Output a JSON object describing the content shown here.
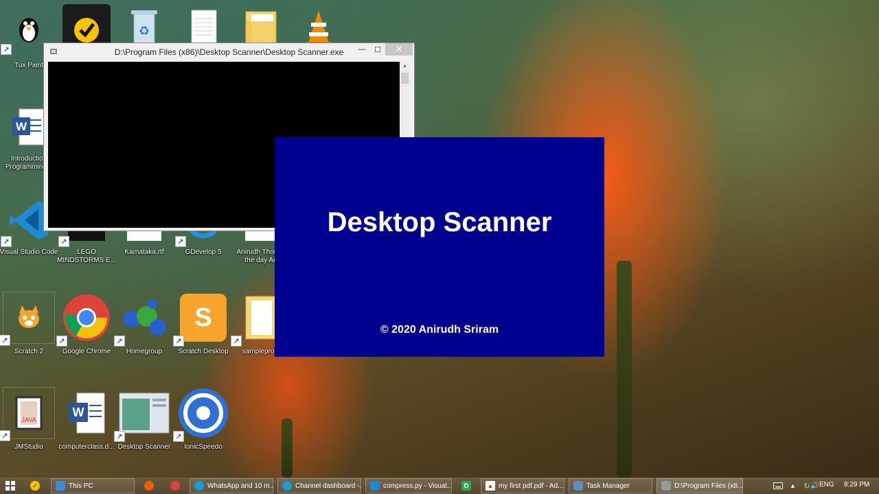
{
  "desktop": {
    "icons": [
      {
        "label": "Tux Paint"
      },
      {
        "label": "Introduction Programming..."
      },
      {
        "label": "Visual Studio Code"
      },
      {
        "label": "LEGO MINDSTORMS E..."
      },
      {
        "label": "Karnataka.rtf"
      },
      {
        "label": "GDevelop 5"
      },
      {
        "label": "Anirudh Thou of the day Au"
      },
      {
        "label": "Scratch 2"
      },
      {
        "label": "Google Chrome"
      },
      {
        "label": "Homegroup"
      },
      {
        "label": "Scratch Desktop"
      },
      {
        "label": "sampleproje"
      },
      {
        "label": "JMStudio"
      },
      {
        "label": "computerclass.d..."
      },
      {
        "label": "Desktop Scanner"
      },
      {
        "label": "IonicSpeedo"
      }
    ]
  },
  "console_window": {
    "title": "D:\\Program Files (x86)\\Desktop Scanner\\Desktop Scanner.exe",
    "minimize_glyph": "—",
    "maximize_glyph": "☐",
    "close_glyph": "✕"
  },
  "splash": {
    "title": "Desktop Scanner",
    "copyright": "© 2020 Anirudh Sriram"
  },
  "taskbar": {
    "items": [
      {
        "label": "This PC"
      },
      {
        "label": "WhatsApp and 10 m..."
      },
      {
        "label": "Channel dashboard -..."
      },
      {
        "label": "compress.py - Visual..."
      },
      {
        "label": "my first pdf.pdf - Ad..."
      },
      {
        "label": "Task Manager"
      },
      {
        "label": "D:\\Program Files (x8..."
      }
    ],
    "language": "ENG",
    "time": "8:29 PM"
  },
  "colors": {
    "splash_bg": "#00008f",
    "console_bg": "#000000"
  }
}
